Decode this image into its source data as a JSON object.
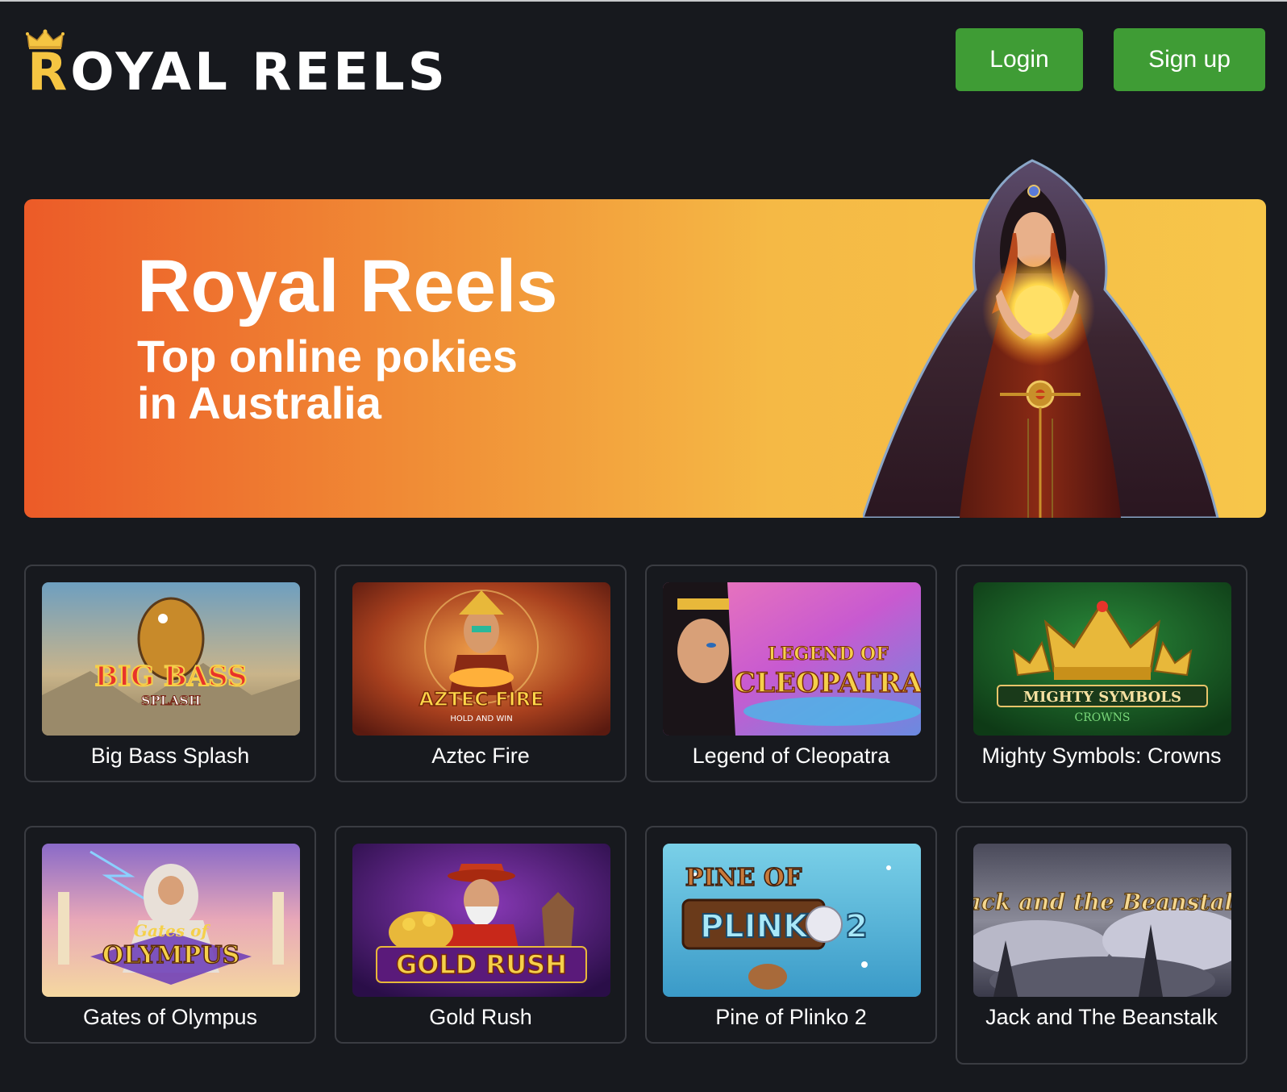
{
  "header": {
    "logo_text_first": "R",
    "logo_text_rest": "OYAL REELS",
    "login_label": "Login",
    "signup_label": "Sign up"
  },
  "hero": {
    "title": "Royal Reels",
    "subtitle_line1": "Top online pokies",
    "subtitle_line2": "in Australia"
  },
  "games": [
    {
      "title": "Big Bass Splash",
      "thumb_text": "BIG BASS",
      "thumb_sub": "SPLASH"
    },
    {
      "title": "Aztec Fire",
      "thumb_text": "AZTEC FIRE",
      "thumb_sub": "HOLD AND WIN"
    },
    {
      "title": "Legend of Cleopatra",
      "thumb_text": "LEGEND OF",
      "thumb_sub": "CLEOPATRA"
    },
    {
      "title": "Mighty Symbols: Crowns",
      "thumb_text": "MIGHTY SYMBOLS",
      "thumb_sub": "CROWNS"
    },
    {
      "title": "Gates of Olympus",
      "thumb_text": "Gates of",
      "thumb_sub": "OLYMPUS"
    },
    {
      "title": "Gold Rush",
      "thumb_text": "GOLD RUSH",
      "thumb_sub": ""
    },
    {
      "title": "Pine of Plinko 2",
      "thumb_text": "PINE OF",
      "thumb_sub": "PLINKO 2"
    },
    {
      "title": "Jack and The Beanstalk",
      "thumb_text": "Jack and the Beanstalk",
      "thumb_sub": ""
    }
  ],
  "colors": {
    "background": "#17191e",
    "button_green": "#3f9c35",
    "logo_gold": "#f5c542",
    "hero_start": "#ec5b28",
    "hero_end": "#f7c64a"
  }
}
